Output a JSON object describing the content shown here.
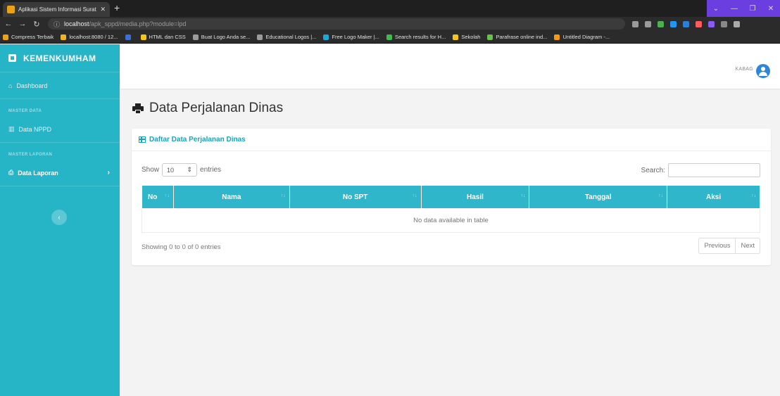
{
  "browser": {
    "tab_title": "Aplikasi Sistem Informasi Surat T",
    "url_host": "localhost",
    "url_path": "/apk_sppd/media.php?module=lpd",
    "bookmarks": [
      {
        "label": "Compress Terbaik",
        "color": "#e8a319"
      },
      {
        "label": "localhost:8080 / 12...",
        "color": "#f0b429"
      },
      {
        "label": "",
        "color": "#3b6fd6"
      },
      {
        "label": "HTML dan CSS",
        "color": "#f5c518"
      },
      {
        "label": "Buat Logo Anda se...",
        "color": "#9b9b9b"
      },
      {
        "label": "Educational Logos |...",
        "color": "#9b9b9b"
      },
      {
        "label": "Free Logo Maker |...",
        "color": "#1fa6d8"
      },
      {
        "label": "Search results for H...",
        "color": "#3fb950"
      },
      {
        "label": "Sekolah",
        "color": "#f5c518"
      },
      {
        "label": "Parafrase online ind...",
        "color": "#6cc04a"
      },
      {
        "label": "Untitled Diagram -...",
        "color": "#f39c12"
      }
    ]
  },
  "sidebar": {
    "brand": "KEMENKUMHAM",
    "dashboard": "Dashboard",
    "heading_master_data": "MASTER DATA",
    "data_nppd": "Data NPPD",
    "heading_master_laporan": "MASTER LAPORAN",
    "data_laporan": "Data Laporan"
  },
  "topbar": {
    "user_role": "KABAG"
  },
  "page": {
    "title": "Data Perjalanan Dinas"
  },
  "panel": {
    "heading": "Daftar Data Perjalanan Dinas",
    "show_label": "Show",
    "page_length": "10",
    "entries_label": "entries",
    "search_label": "Search:",
    "columns": [
      "No",
      "Nama",
      "No SPT",
      "Hasil",
      "Tanggal",
      "Aksi"
    ],
    "empty_message": "No data available in table",
    "info": "Showing 0 to 0 of 0 entries",
    "previous": "Previous",
    "next": "Next"
  },
  "colors": {
    "accent": "#26b5c7",
    "header": "#2fb6ca"
  }
}
